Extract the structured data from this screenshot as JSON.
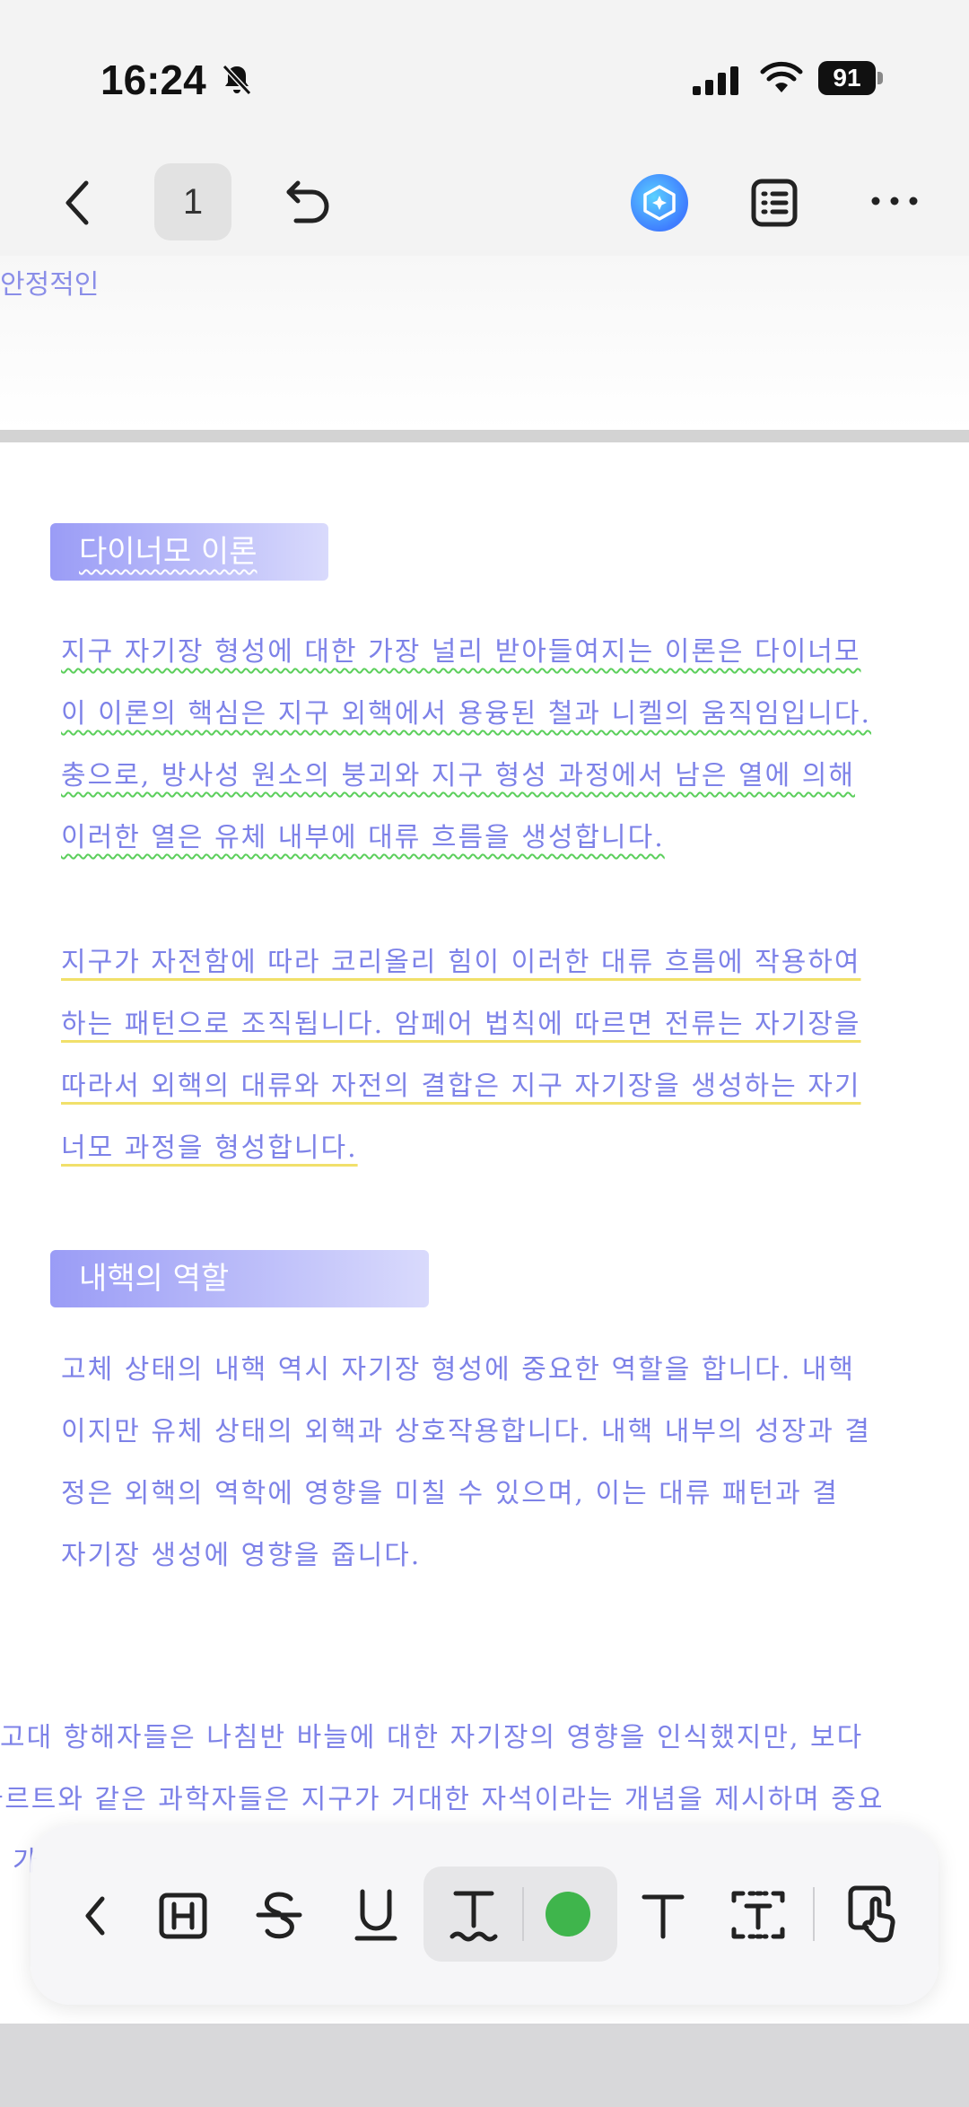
{
  "status_bar": {
    "time": "16:24",
    "battery": "91",
    "icons": [
      "bell-slash-icon",
      "cellular-signal-icon",
      "wifi-icon",
      "battery-icon"
    ]
  },
  "toolbar": {
    "page_number": "1",
    "icons": [
      "back-chevron-icon",
      "undo-icon",
      "ai-assistant-icon",
      "outline-list-icon",
      "more-icon"
    ]
  },
  "document": {
    "previous_page_fragment": "안정적인",
    "sections": [
      {
        "heading": "다이너모 이론",
        "paragraphs": [
          {
            "style": "wavy-green",
            "lines": [
              "지구 자기장 형성에 대한 가장 널리 받아들여지는 이론은 다이너모",
              "이 이론의 핵심은 지구 외핵에서 용융된 철과 니켈의 움직임입니다.",
              "충으로, 방사성 원소의 붕괴와 지구 형성 과정에서 남은 열에 의해",
              "이러한 열은 유체 내부에 대류 흐름을 생성합니다."
            ]
          },
          {
            "style": "yellow-underline",
            "lines": [
              "지구가 자전함에 따라 코리올리 힘이 이러한 대류 흐름에 작용하여",
              "하는 패턴으로 조직됩니다. 암페어 법칙에 따르면 전류는 자기장을",
              "따라서 외핵의 대류와 자전의 결합은 지구 자기장을 생성하는 자기",
              "너모 과정을 형성합니다."
            ]
          }
        ]
      },
      {
        "heading": "내핵의 역할",
        "paragraphs": [
          {
            "style": "plain",
            "lines": [
              "고체 상태의 내핵 역시 자기장 형성에 중요한 역할을 합니다. 내핵",
              "이지만 유체 상태의 외핵과 상호작용합니다. 내핵 내부의 성장과 결",
              "정은 외핵의 역학에 영향을 미칠 수 있으며, 이는 대류 패턴과 결",
              "자기장 생성에 영향을 줍니다."
            ]
          }
        ]
      }
    ],
    "bottom_lines": [
      "고대 항해자들은 나침반 바늘에 대한 자기장의 영향을 인식했지만, 보다",
      "데카르트와 같은 과학자들은 지구가 거대한 자석이라는 개념을 제시하며 중요",
      "가"
    ]
  },
  "format_toolbar": {
    "tools": [
      {
        "name": "collapse-icon"
      },
      {
        "name": "heading-icon"
      },
      {
        "name": "strikethrough-icon"
      },
      {
        "name": "underline-icon"
      },
      {
        "name": "wavy-underline-icon",
        "selected": true
      },
      {
        "name": "color-swatch",
        "color": "#3fb54c"
      },
      {
        "name": "text-style-icon"
      },
      {
        "name": "text-box-icon"
      },
      {
        "name": "touch-select-icon"
      }
    ]
  },
  "colors": {
    "text": "#7d82e8",
    "heading_start": "#9a9cf6",
    "heading_end": "#d9dafc",
    "wavy_underline": "#5ccf5c",
    "yellow_underline": "#f1e06a"
  }
}
